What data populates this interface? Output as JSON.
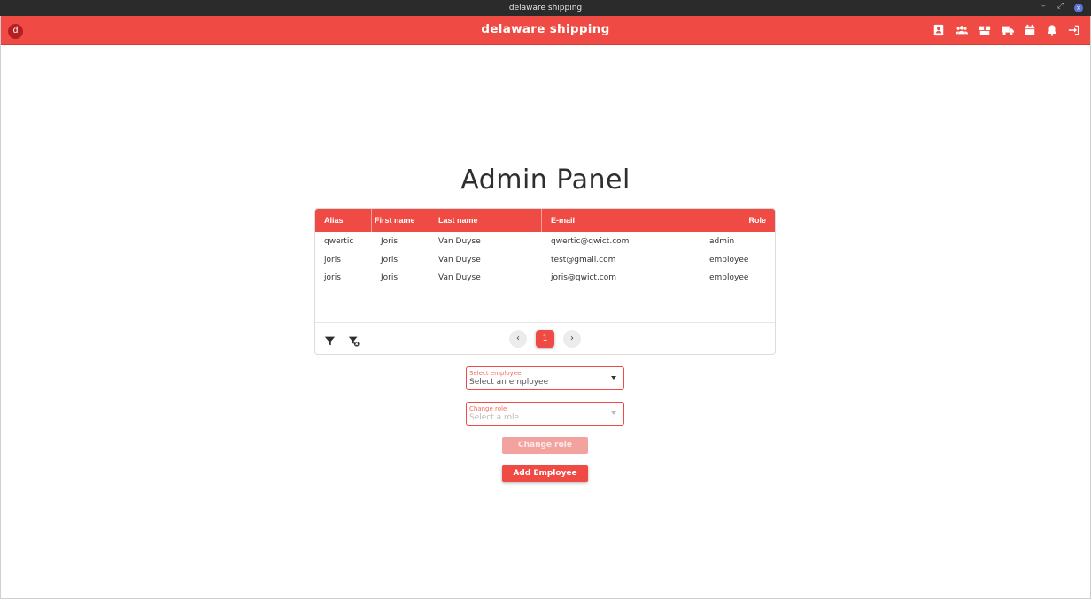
{
  "os": {
    "window_title": "delaware shipping",
    "min_icon": "minimize-icon",
    "max_icon": "maximize-icon",
    "close_icon": "close-icon",
    "min_glyph": "–",
    "max_glyph": "⤢",
    "close_glyph": "×"
  },
  "header": {
    "logo_letter": "d",
    "title": "delaware shipping",
    "icons": [
      "contact-card-icon",
      "users-icon",
      "boxes-icon",
      "truck-icon",
      "calendar-icon",
      "bell-icon",
      "logout-icon"
    ]
  },
  "page": {
    "title": "Admin Panel"
  },
  "table": {
    "columns": [
      "Alias",
      "First name",
      "Last name",
      "E-mail",
      "Role"
    ],
    "rows": [
      [
        "qwertic",
        "Joris",
        "Van Duyse",
        "qwertic@qwict.com",
        "admin"
      ],
      [
        "joris",
        "Joris",
        "Van Duyse",
        "test@gmail.com",
        "employee"
      ],
      [
        "joris",
        "Joris",
        "Van Duyse",
        "joris@qwict.com",
        "employee"
      ]
    ],
    "pagination": {
      "current": "1",
      "prev": "‹",
      "next": "›"
    },
    "footer_icons": [
      "filter-icon",
      "clear-filter-icon"
    ]
  },
  "form": {
    "employee_select": {
      "label": "Select employee",
      "value": "Select an employee"
    },
    "role_select": {
      "label": "Change role",
      "placeholder": "Select a role"
    },
    "change_role_button": "Change role",
    "add_employee_button": "Add Employee"
  },
  "colors": {
    "brand": "#ef4a43",
    "title_bar": "#2b2b2b"
  }
}
